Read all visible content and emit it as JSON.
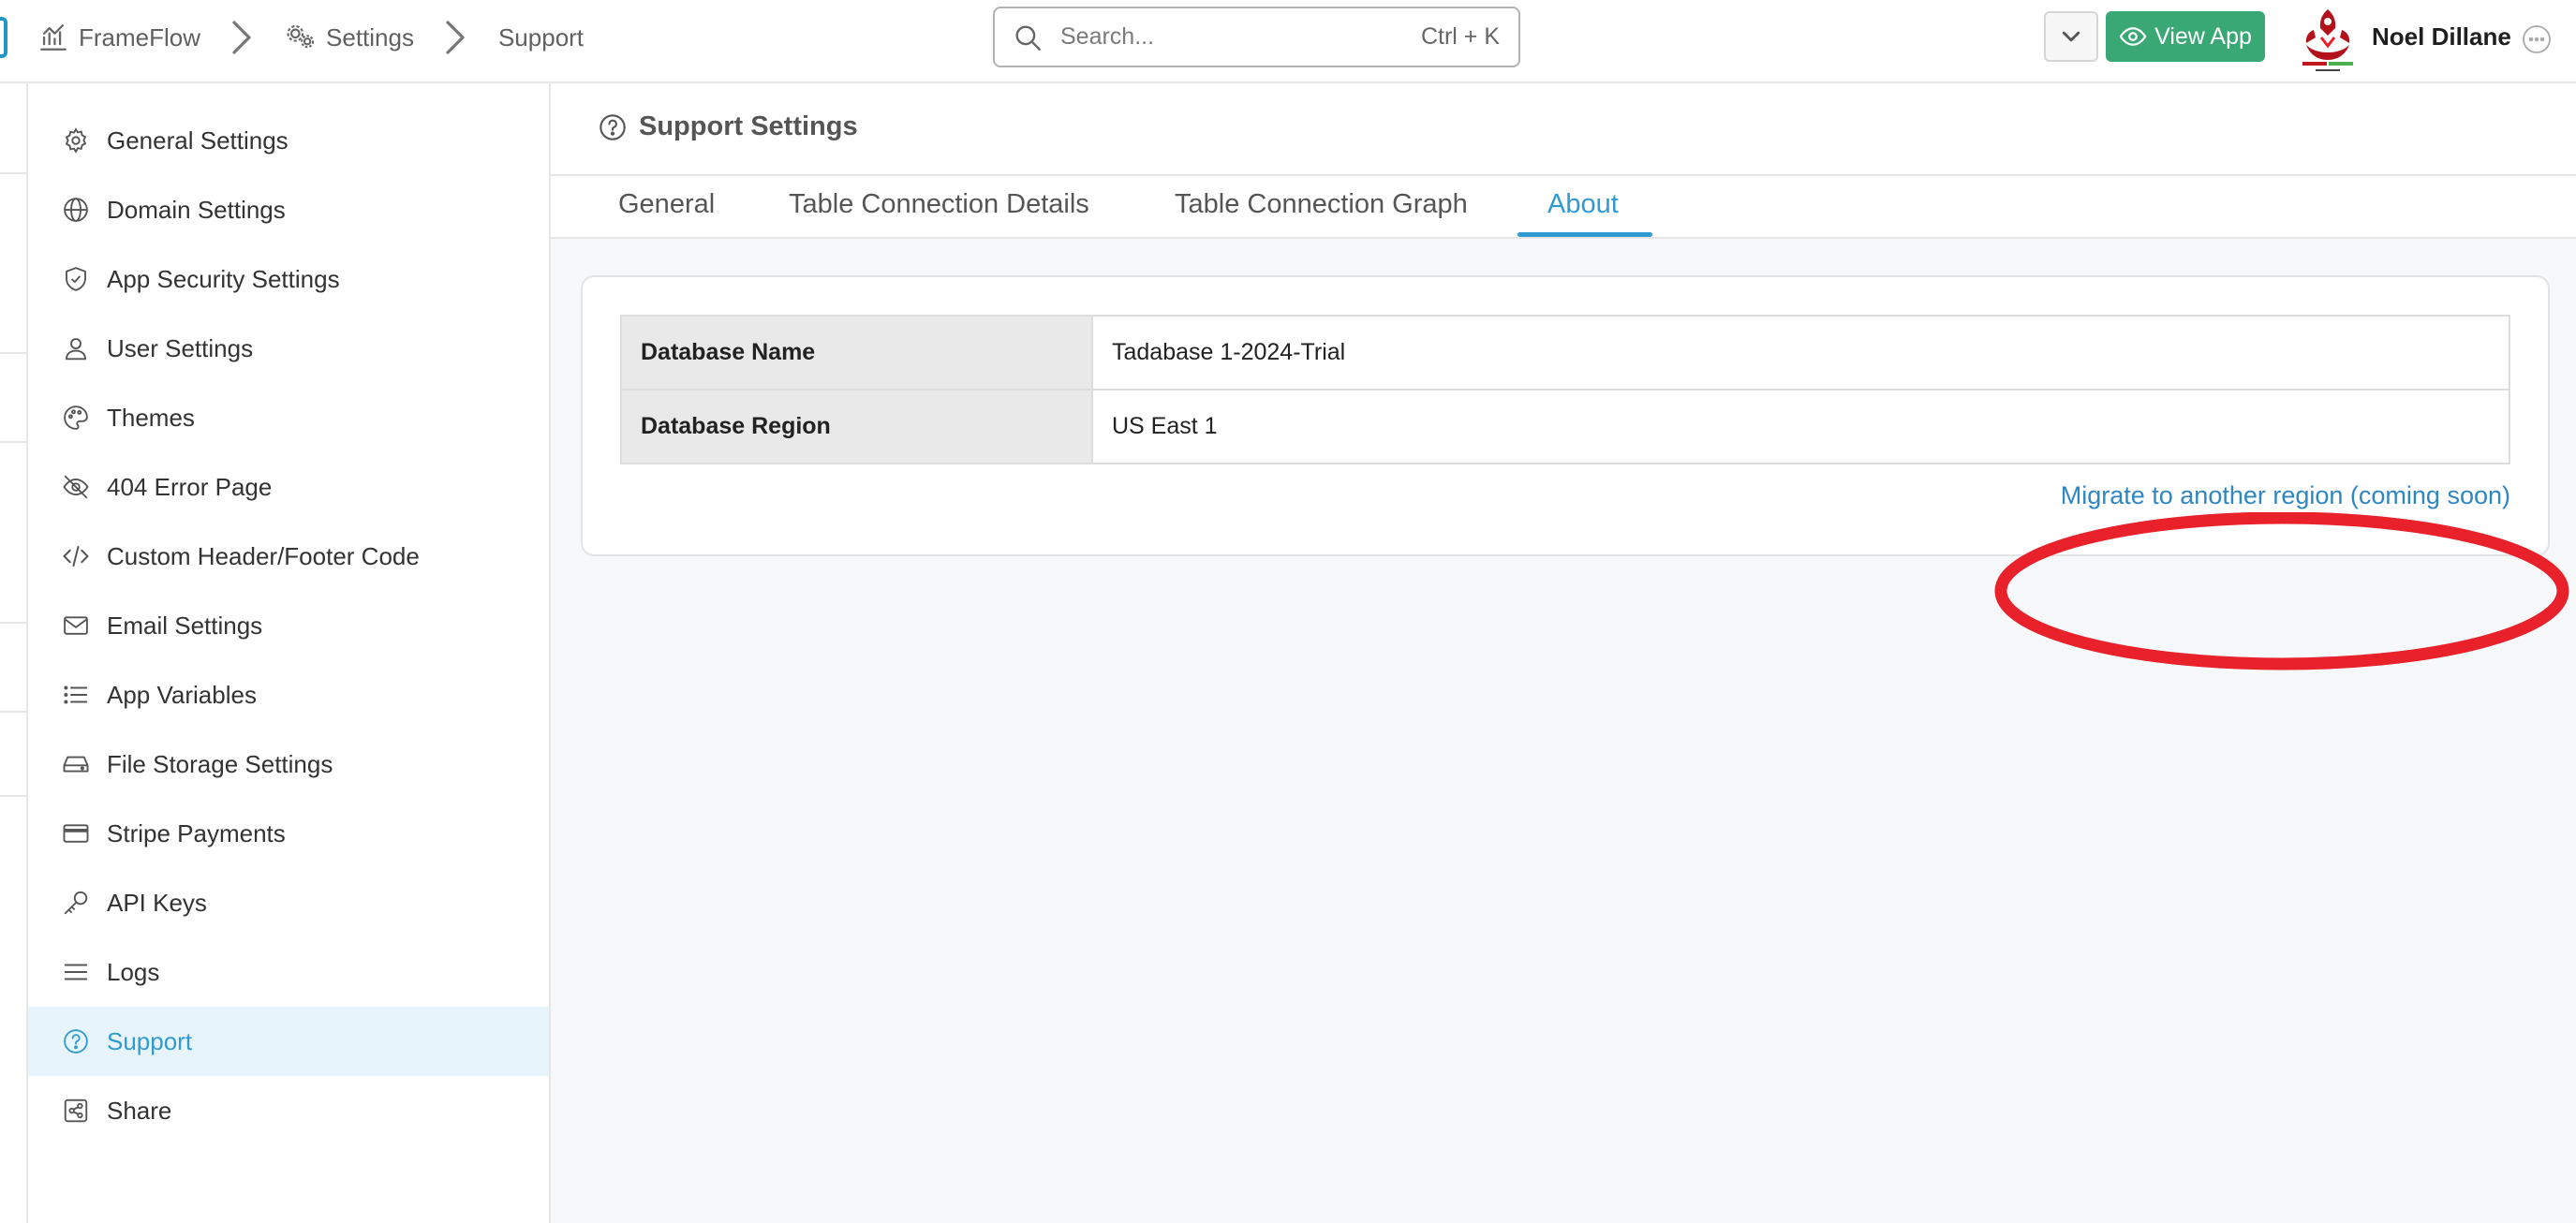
{
  "breadcrumb": {
    "app": "FrameFlow",
    "section": "Settings",
    "page": "Support"
  },
  "search": {
    "placeholder": "Search...",
    "shortcut": "Ctrl + K"
  },
  "header": {
    "view_app_label": "View App",
    "user_name": "Noel Dillane"
  },
  "sidebar": {
    "items": [
      {
        "label": "General Settings",
        "icon": "gear-icon"
      },
      {
        "label": "Domain Settings",
        "icon": "globe-icon"
      },
      {
        "label": "App Security Settings",
        "icon": "shield-icon"
      },
      {
        "label": "User Settings",
        "icon": "user-icon"
      },
      {
        "label": "Themes",
        "icon": "palette-icon"
      },
      {
        "label": "404 Error Page",
        "icon": "eye-slash-icon"
      },
      {
        "label": "Custom Header/Footer Code",
        "icon": "code-icon"
      },
      {
        "label": "Email Settings",
        "icon": "envelope-icon"
      },
      {
        "label": "App Variables",
        "icon": "list-icon"
      },
      {
        "label": "File Storage Settings",
        "icon": "hard-drive-icon"
      },
      {
        "label": "Stripe Payments",
        "icon": "credit-card-icon"
      },
      {
        "label": "API Keys",
        "icon": "key-icon"
      },
      {
        "label": "Logs",
        "icon": "lines-icon"
      },
      {
        "label": "Support",
        "icon": "question-circle-icon",
        "active": true
      },
      {
        "label": "Share",
        "icon": "share-icon"
      }
    ]
  },
  "main": {
    "title": "Support Settings",
    "tabs": [
      {
        "label": "General"
      },
      {
        "label": "Table Connection Details"
      },
      {
        "label": "Table Connection Graph"
      },
      {
        "label": "About",
        "active": true
      }
    ],
    "about": {
      "rows": [
        {
          "key": "Database Name",
          "value": "Tadabase 1-2024-Trial"
        },
        {
          "key": "Database Region",
          "value": "US East 1"
        }
      ],
      "migrate_link": "Migrate to another region (coming soon)"
    }
  },
  "colors": {
    "accent": "#2f9bd0",
    "view_app_green": "#3aa874",
    "highlight_red": "#e8212b",
    "active_bg": "#e7f4fb"
  }
}
